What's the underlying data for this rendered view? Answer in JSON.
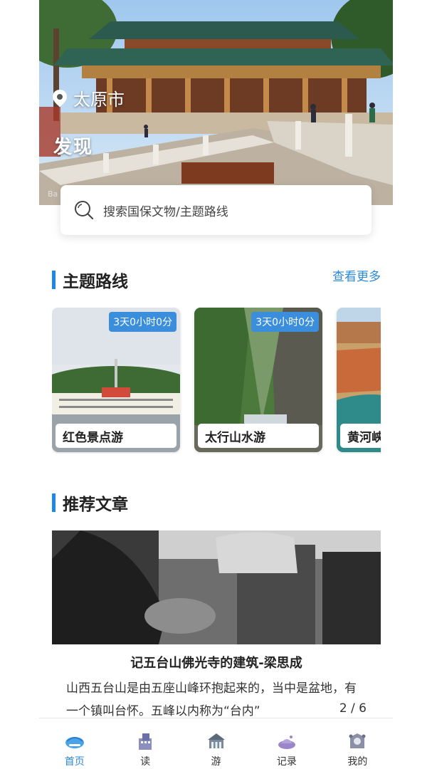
{
  "hero": {
    "city": "太原市",
    "title": "发现",
    "watermark": "Ba"
  },
  "search": {
    "placeholder": "搜索国保文物/主题路线"
  },
  "routes_section": {
    "title": "主题路线",
    "more": "查看更多",
    "cards": [
      {
        "duration": "3天0小时0分",
        "name": "红色景点游"
      },
      {
        "duration": "3天0小时0分",
        "name": "太行山水游"
      },
      {
        "duration": "",
        "name": "黄河峡"
      }
    ]
  },
  "articles_section": {
    "title": "推荐文章",
    "article": {
      "title": "记五台山佛光寺的建筑-梁思成",
      "body": "山西五台山是由五座山峰环抱起来的，当中是盆地，有一个镇叫台怀。五峰以内称为“台内”",
      "pager": "2 / 6"
    }
  },
  "tabbar": {
    "tabs": [
      {
        "label": "首页",
        "icon": "home-icon",
        "active": true
      },
      {
        "label": "读",
        "icon": "read-icon",
        "active": false
      },
      {
        "label": "游",
        "icon": "travel-icon",
        "active": false
      },
      {
        "label": "记录",
        "icon": "record-icon",
        "active": false
      },
      {
        "label": "我的",
        "icon": "profile-icon",
        "active": false
      }
    ]
  },
  "colors": {
    "accent": "#1e88e5",
    "link": "#2a8ad8",
    "badge": "#3b8edb"
  }
}
